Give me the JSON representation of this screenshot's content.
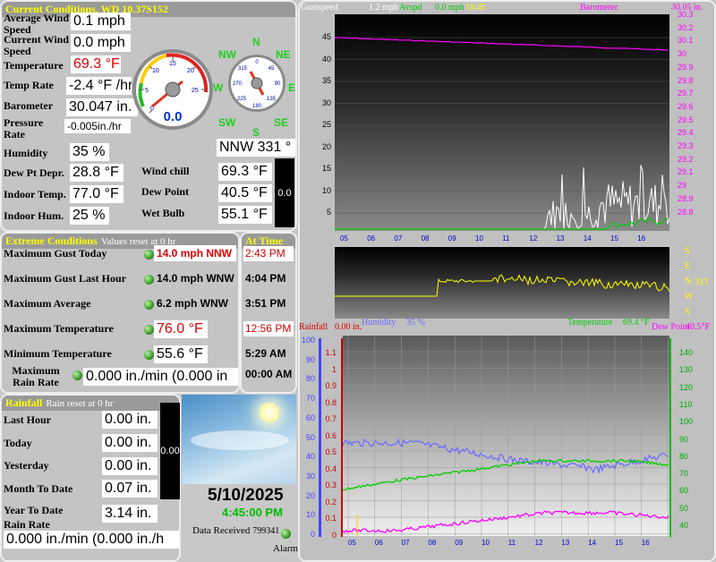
{
  "current": {
    "title": "Current Conditions, WD 10.37S152",
    "avg_wind_label": "Average Wind Speed",
    "avg_wind": "0.1 mph",
    "cur_wind_label": "Current Wind Speed",
    "cur_wind": "0.0 mph",
    "temp_label": "Temperature",
    "temp": "69.3 °F",
    "temp_rate_label": "Temp Rate",
    "temp_rate": "-2.4 °F /hr",
    "baro_label": "Barometer",
    "baro": "30.047 in.",
    "pressure_rate_label": "Pressure Rate",
    "pressure_rate": "-0.005in./hr",
    "humidity_label": "Humidity",
    "humidity": "35 %",
    "dewdep_label": "Dew Pt Depr.",
    "dewdep": "28.8 °F",
    "indoor_temp_label": "Indoor Temp.",
    "indoor_temp": "77.0 °F",
    "indoor_hum_label": "Indoor Hum.",
    "indoor_hum": "25 %",
    "windchill_label": "Wind chill",
    "windchill": "69.3 °F",
    "dewpoint_label": "Dew Point",
    "dewpoint": "40.5 °F",
    "wetbulb_label": "Wet Bulb",
    "wetbulb": "55.1 °F",
    "wind_dir": "NNW  331 °",
    "rain_bar": "0.0",
    "gauge_value": "0.0",
    "gauge_ticks": [
      "0",
      "5",
      "10",
      "15",
      "20",
      "25"
    ],
    "compass": {
      "n": "N",
      "ne": "NE",
      "e": "E",
      "se": "SE",
      "s": "S",
      "sw": "SW",
      "w": "W",
      "nw": "NW"
    },
    "compass_ticks": [
      "0",
      "45",
      "90",
      "135",
      "180",
      "225",
      "270",
      "315"
    ]
  },
  "extremes": {
    "title": "Extreme Conditions",
    "sub": "Values reset at 0 hr",
    "at_time_title": "At Time",
    "rows": [
      {
        "label": "Maximum Gust Today",
        "value": "14.0 mph NNW",
        "time": "2:43 PM",
        "red": true
      },
      {
        "label": "Maximum Gust Last Hour",
        "value": "14.0 mph WNW",
        "time": "4:04 PM",
        "red": false
      },
      {
        "label": "Maximum Average",
        "value": "6.2 mph WNW",
        "time": "3:51 PM",
        "red": false
      },
      {
        "label": "Maximum Temperature",
        "value": "76.0 °F",
        "time": "12:56 PM",
        "red": true
      },
      {
        "label": "Minimum Temperature",
        "value": "55.6 °F",
        "time": "5:29 AM",
        "red": false
      },
      {
        "label": "Maximum Rain Rate",
        "value": "0.000 in./min (0.000 in",
        "time": "00:00 AM",
        "red": false
      }
    ]
  },
  "rainfall": {
    "title": "Rainfall",
    "sub": "Rain reset at 0 hr",
    "last_hour_label": "Last Hour",
    "last_hour": "0.00 in.",
    "today_label": "Today",
    "today": "0.00 in.",
    "yesterday_label": "Yesterday",
    "yesterday": "0.00 in.",
    "month_label": "Month To Date",
    "month": "0.07 in.",
    "year_label": "Year To Date",
    "year": "3.14 in.",
    "rate_label": "Rain Rate",
    "rate": "0.000 in./min (0.000 in./h",
    "bar": "0.00"
  },
  "status": {
    "date": "5/10/2025",
    "time": "4:45:00 PM",
    "data_received_label": "Data Received",
    "data_received": "799341",
    "alarm_label": "Alarm"
  },
  "graph_wind": {
    "gust_label": "Gustspeed",
    "gust_val": "1.2 mph",
    "avg_label": "Avspd",
    "avg_val": "0.0 mph",
    "time": "16:45",
    "baro_label": "Barometer",
    "baro_val": "30.05 in.",
    "left_ticks": [
      "45",
      "40",
      "35",
      "30",
      "25",
      "20",
      "15",
      "10",
      "5"
    ],
    "right_ticks": [
      "30.3",
      "30.2",
      "30.1",
      "30",
      "29.9",
      "29.8",
      "29.7",
      "29.6",
      "29.5",
      "29.4",
      "29.3",
      "29.2",
      "29.1",
      "29",
      "28.9",
      "28.8"
    ],
    "x_ticks": [
      "05",
      "06",
      "07",
      "08",
      "09",
      "10",
      "11",
      "12",
      "13",
      "14",
      "15",
      "16"
    ]
  },
  "graph_dir": {
    "compass": [
      "S",
      "E",
      "N",
      "W",
      "S"
    ],
    "value": "313"
  },
  "graph_temp": {
    "rainfall_label": "Rainfall",
    "rainfall_val": "0.00 in.",
    "humidity_label": "Humidity",
    "humidity_val": "35 %",
    "temp_label": "Temperature",
    "temp_val": "69.4 °F",
    "dew_label": "Dew Point",
    "dew_val": "40.5°F",
    "hum_ticks": [
      "100",
      "90",
      "80",
      "70",
      "60",
      "50",
      "40",
      "30",
      "20",
      "10",
      "0"
    ],
    "rain_ticks": [
      "1.1",
      "1",
      "0.9",
      "0.8",
      "0.7",
      "0.6",
      "0.5",
      "0.4",
      "0.3",
      "0.2",
      "0.1",
      "0"
    ],
    "temp_ticks": [
      "140",
      "130",
      "120",
      "110",
      "100",
      "90",
      "80",
      "70",
      "60",
      "50",
      "40"
    ],
    "x_ticks": [
      "05",
      "06",
      "07",
      "08",
      "09",
      "10",
      "11",
      "12",
      "13",
      "14",
      "15",
      "16"
    ]
  },
  "colors": {
    "accent_title": "#ffff00",
    "baro_line": "#ff00ff",
    "avg_line": "#00cc00",
    "gust_line": "#ffffff",
    "dir_line": "#ffff00",
    "humidity_line": "#6a6aff",
    "temp_line": "#00cc00",
    "dew_line": "#ff00ff"
  }
}
